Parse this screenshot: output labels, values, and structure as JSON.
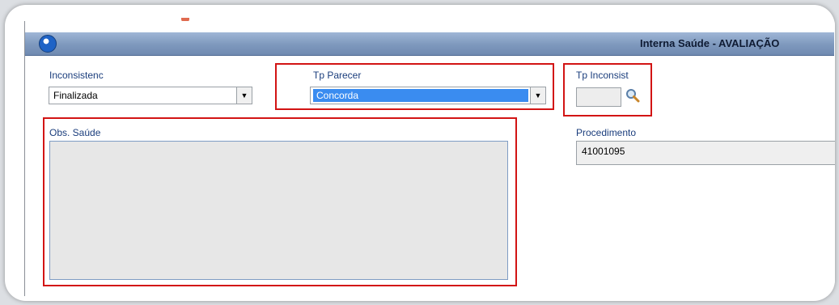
{
  "window": {
    "title": "Interna Saúde - AVALIAÇÃO"
  },
  "fields": {
    "inconsistenc": {
      "label": "Inconsistenc",
      "value": "Finalizada"
    },
    "tp_parecer": {
      "label": "Tp Parecer",
      "value": "Concorda"
    },
    "tp_inconsist": {
      "label": "Tp Inconsist",
      "value": ""
    },
    "obs_saude": {
      "label": "Obs. Saúde",
      "value": ""
    },
    "procedimento": {
      "label": "Procedimento",
      "value": "41001095"
    }
  },
  "colors": {
    "highlight": "#d21414",
    "selection": "#3a8cf0",
    "label": "#1a3d7c"
  },
  "icons": {
    "search": "magnifier-icon",
    "dropdown": "chevron-down-icon",
    "app": "app-logo-icon"
  }
}
